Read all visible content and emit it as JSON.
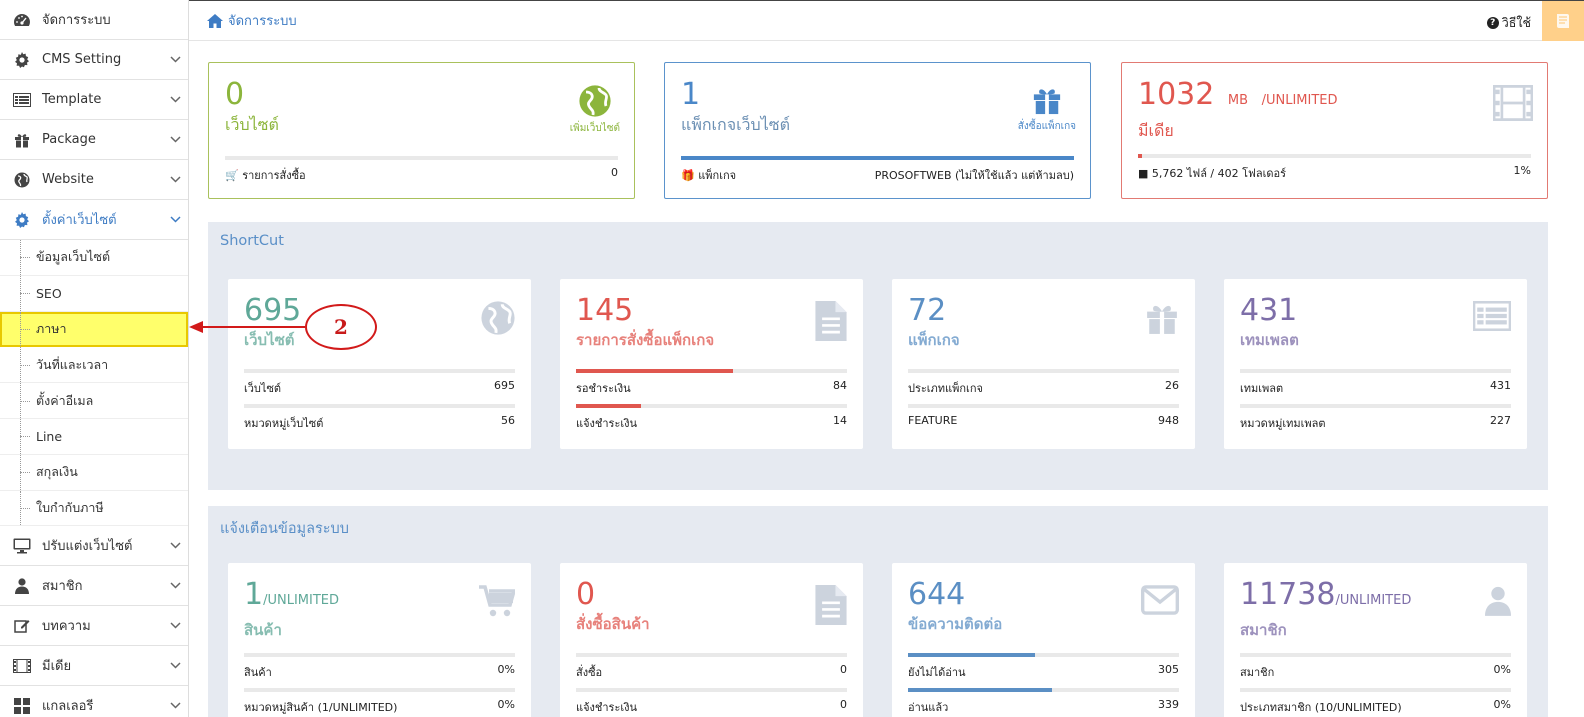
{
  "sidebar": {
    "items": [
      {
        "label": "จัดการระบบ",
        "icon": "dashboard-icon"
      },
      {
        "label": "CMS Setting",
        "icon": "gear-icon"
      },
      {
        "label": "Template",
        "icon": "list-icon"
      },
      {
        "label": "Package",
        "icon": "gift-icon"
      },
      {
        "label": "Website",
        "icon": "globe-icon"
      },
      {
        "label": "ตั้งค่าเว็บไซต์",
        "icon": "gear-icon"
      }
    ],
    "submenu": [
      "ข้อมูลเว็บไซต์",
      "SEO",
      "ภาษา",
      "วันที่และเวลา",
      "ตั้งค่าอีเมล",
      "Line",
      "สกุลเงิน",
      "ใบกำกับภาษี"
    ],
    "items_after": [
      {
        "label": "ปรับแต่งเว็บไซต์",
        "icon": "monitor-icon"
      },
      {
        "label": "สมาชิก",
        "icon": "user-icon"
      },
      {
        "label": "บทความ",
        "icon": "edit-icon"
      },
      {
        "label": "มีเดีย",
        "icon": "film-icon"
      },
      {
        "label": "แกลเลอรี",
        "icon": "grid-icon"
      }
    ]
  },
  "header": {
    "breadcrumb": "จัดการระบบ",
    "help": "วิธีใช้"
  },
  "stats": {
    "websites": {
      "num": "0",
      "label": "เว็บไซต์",
      "action": "เพิ่มเว็บไซต์",
      "foot_label": "รายการสั่งซื้อ",
      "foot_value": "0",
      "color": "#8cb53c",
      "progress": 0
    },
    "package": {
      "num": "1",
      "label": "แพ็กเกจเว็บไซต์",
      "action": "สั่งซื้อแพ็กเกจ",
      "foot_label": "แพ็กเกจ",
      "foot_value": "PROSOFTWEB (ไม่ให้ใช้แล้ว แต่ห้ามลบ)",
      "color": "#4a87c8",
      "progress": 1
    },
    "media": {
      "num": "1032",
      "unit": "MB",
      "limit": "/UNLIMITED",
      "label": "มีเดีย",
      "foot_label": "5,762 ไฟล์ / 402 โฟลเดอร์",
      "foot_value": "1%",
      "color": "#e0574f",
      "progress": 0.01
    }
  },
  "shortcut": {
    "title": "ShortCut",
    "cards": [
      {
        "num": "695",
        "label": "เว็บไซต์",
        "color": "#5fa898",
        "icon": "globe-icon",
        "rows": [
          {
            "label": "เว็บไซต์",
            "value": "695",
            "progress": 0
          },
          {
            "label": "หมวดหมู่เว็บไซต์",
            "value": "56",
            "progress": 0
          }
        ]
      },
      {
        "num": "145",
        "label": "รายการสั่งซื้อแพ็กเกจ",
        "color": "#e0574f",
        "icon": "file-icon",
        "rows": [
          {
            "label": "รอชำระเงิน",
            "value": "84",
            "progress": 0.58
          },
          {
            "label": "แจ้งชำระเงิน",
            "value": "14",
            "progress": 0.24
          }
        ]
      },
      {
        "num": "72",
        "label": "แพ็กเกจ",
        "color": "#5b8fc4",
        "icon": "gift-icon",
        "rows": [
          {
            "label": "ประเภทแพ็กเกจ",
            "value": "26",
            "progress": 0
          },
          {
            "label": "FEATURE",
            "value": "948",
            "progress": 0
          }
        ]
      },
      {
        "num": "431",
        "label": "เทมเพลต",
        "color": "#7d6ea8",
        "icon": "list-icon",
        "rows": [
          {
            "label": "เทมเพลต",
            "value": "431",
            "progress": 0
          },
          {
            "label": "หมวดหมู่เทมเพลต",
            "value": "227",
            "progress": 0
          }
        ]
      }
    ]
  },
  "alerts": {
    "title": "แจ้งเตือนข้อมูลระบบ",
    "cards": [
      {
        "num": "1",
        "suffix": "/UNLIMITED",
        "label": "สินค้า",
        "color": "#5fa898",
        "icon": "cart-icon",
        "rows": [
          {
            "label": "สินค้า",
            "value": "0%",
            "progress": 0
          },
          {
            "label": "หมวดหมู่สินค้า (1/UNLIMITED)",
            "value": "0%",
            "progress": 0
          }
        ]
      },
      {
        "num": "0",
        "suffix": "",
        "label": "สั่งซื้อสินค้า",
        "color": "#e0574f",
        "icon": "file-icon",
        "rows": [
          {
            "label": "สั่งซื้อ",
            "value": "0",
            "progress": 0
          },
          {
            "label": "แจ้งชำระเงิน",
            "value": "0",
            "progress": 0
          }
        ]
      },
      {
        "num": "644",
        "suffix": "",
        "label": "ข้อความติดต่อ",
        "color": "#5b8fc4",
        "icon": "envelope-icon",
        "rows": [
          {
            "label": "ยังไม่ได้อ่าน",
            "value": "305",
            "progress": 0.47
          },
          {
            "label": "อ่านแล้ว",
            "value": "339",
            "progress": 0.53
          }
        ]
      },
      {
        "num": "11738",
        "suffix": "/UNLIMITED",
        "label": "สมาชิก",
        "color": "#7d6ea8",
        "icon": "user-icon",
        "rows": [
          {
            "label": "สมาชิก",
            "value": "0%",
            "progress": 0
          },
          {
            "label": "ประเภทสมาชิก (10/UNLIMITED)",
            "value": "0%",
            "progress": 0
          }
        ]
      }
    ]
  },
  "annotation": {
    "number": "2"
  }
}
